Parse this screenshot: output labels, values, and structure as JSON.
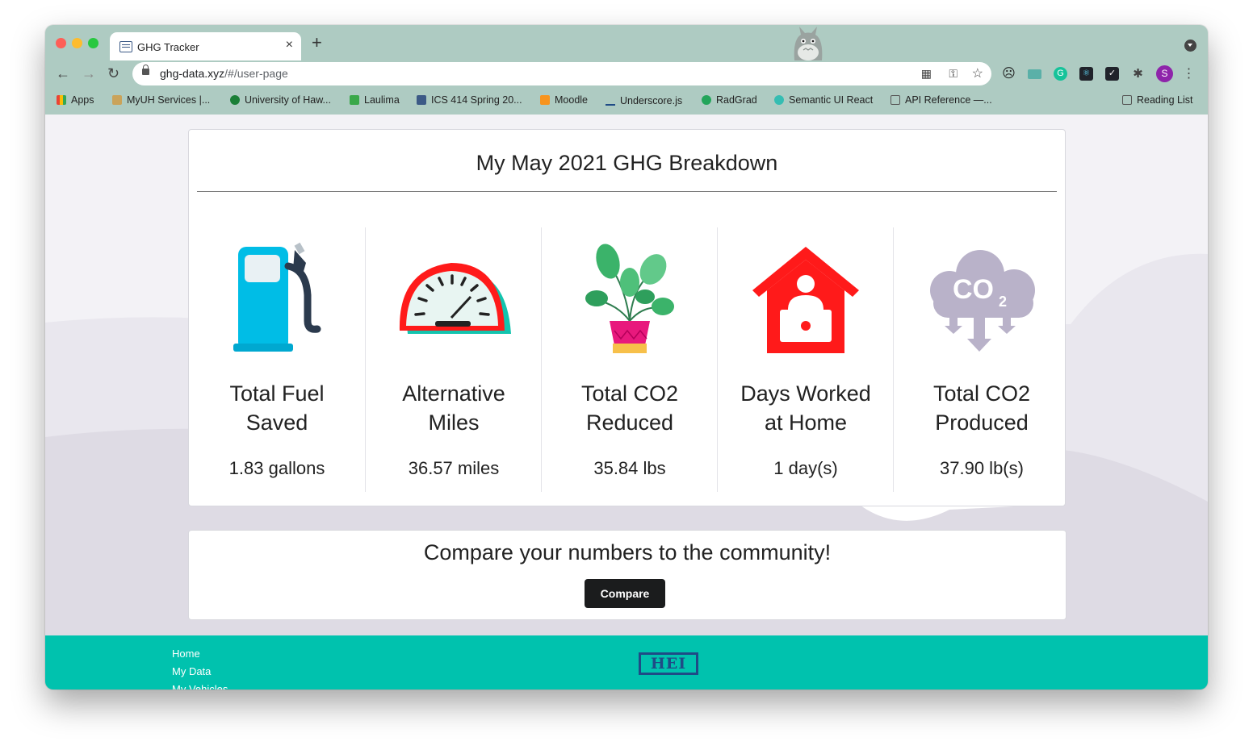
{
  "browser": {
    "tab_title": "GHG Tracker",
    "tab_close": "×",
    "new_tab": "+",
    "url_host": "ghg-data.xyz",
    "url_path": "/#/user-page",
    "profile_initial": "S",
    "bookmarks": [
      {
        "label": "Apps",
        "color": "#4285f4"
      },
      {
        "label": "MyUH Services |...",
        "color": "#caa35a"
      },
      {
        "label": "University of Haw...",
        "color": "#1a7f37"
      },
      {
        "label": "Laulima",
        "color": "#3aa84a"
      },
      {
        "label": "ICS 414 Spring 20...",
        "color": "#3c5a86"
      },
      {
        "label": "Moodle",
        "color": "#f7941e"
      },
      {
        "label": "Underscore.js",
        "color": "#1f4b86"
      },
      {
        "label": "RadGrad",
        "color": "#23a55a"
      },
      {
        "label": "Semantic UI React",
        "color": "#35bdb2"
      },
      {
        "label": "API Reference —...",
        "color": "#555555"
      }
    ],
    "reading_list": "Reading List"
  },
  "breakdown": {
    "title": "My May 2021 GHG Breakdown",
    "stats": [
      {
        "icon": "fuel-pump-icon",
        "label_line1": "Total Fuel",
        "label_line2": "Saved",
        "value": "1.83 gallons"
      },
      {
        "icon": "speedometer-icon",
        "label_line1": "Alternative",
        "label_line2": "Miles",
        "value": "36.57 miles"
      },
      {
        "icon": "potted-plant-icon",
        "label_line1": "Total CO2",
        "label_line2": "Reduced",
        "value": "35.84 lbs"
      },
      {
        "icon": "home-office-icon",
        "label_line1": "Days Worked",
        "label_line2": "at Home",
        "value": "1 day(s)"
      },
      {
        "icon": "co2-cloud-icon",
        "label_line1": "Total CO2",
        "label_line2": "Produced",
        "value": "37.90 lb(s)"
      }
    ]
  },
  "compare": {
    "title": "Compare your numbers to the community!",
    "button_label": "Compare"
  },
  "footer": {
    "links": [
      "Home",
      "My Data",
      "My Vehicles"
    ],
    "logo_text": "HEI"
  },
  "colors": {
    "browser_chrome": "#aecbc2",
    "footer": "#00c2ae",
    "fuel_pump": "#00bde6",
    "gauge_red": "#ff1a1a",
    "house_red": "#ff1a1a",
    "cloud_lilac": "#b9b2c9",
    "button": "#1b1c1d"
  }
}
